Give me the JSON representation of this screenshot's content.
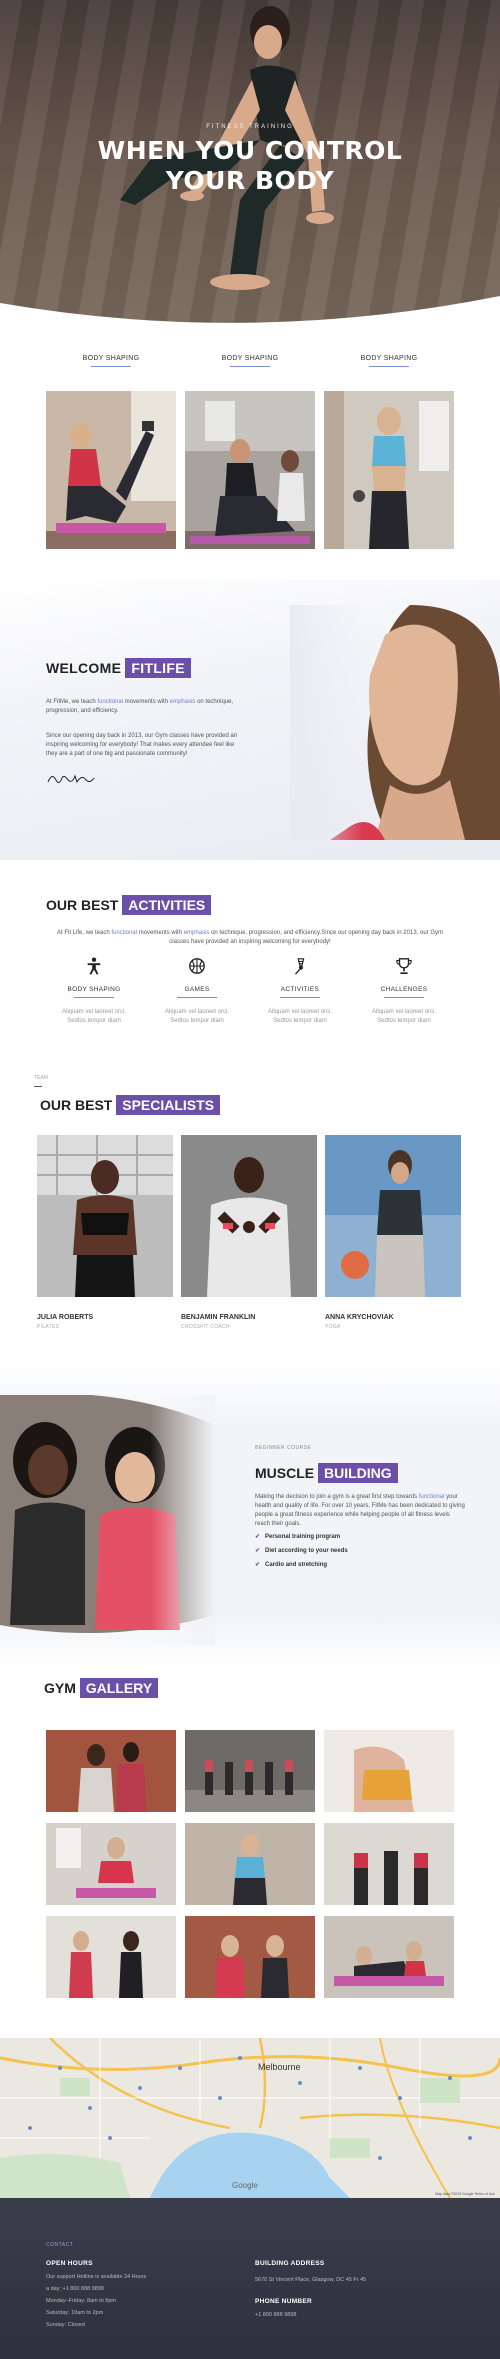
{
  "hero": {
    "tagline": "FITNESS TRAINING",
    "title_line1": "WHEN YOU CONTROL",
    "title_line2": "YOUR BODY"
  },
  "shaping": {
    "items": [
      {
        "label": "BODY SHAPING"
      },
      {
        "label": "BODY SHAPING"
      },
      {
        "label": "BODY SHAPING"
      }
    ]
  },
  "welcome": {
    "title_plain": "WELCOME",
    "title_accent": "FITLIFE",
    "p1_a": "At FitMe, we teach ",
    "p1_hl1": "functional",
    "p1_b": " movements with ",
    "p1_hl2": "emphasis",
    "p1_c": " on technique, progression, and efficiency.",
    "p2": "Since our opening day back in 2013, our Gym classes have provided an inspiring welcoming for everybody! That makes every attendee feel like they are a part of one big and passionate community!",
    "signature": "Dave Bm"
  },
  "activities": {
    "title_plain": "OUR BEST",
    "title_accent": "ACTIVITIES",
    "intro_a": "At Fit Life, we teach ",
    "intro_hl1": "functional",
    "intro_b": " movements with ",
    "intro_hl2": "emphasis",
    "intro_c": " on technique, progression, and efficiency.Since our opening day back in 2013, our Gym classes have provided an inspiring welcoming for everybody!",
    "items": [
      {
        "label": "BODY SHAPING",
        "desc": "Aliquam vel laoreet orci. Sedtos tempor diam",
        "icon": "fitness-person-icon"
      },
      {
        "label": "GAMES",
        "desc": "Aliquam vel laoreet orci. Sedtos tempor diam",
        "icon": "basketball-icon"
      },
      {
        "label": "ACTIVITIES",
        "desc": "Aliquam vel laoreet orci. Sedtos tempor diam",
        "icon": "badminton-icon"
      },
      {
        "label": "CHALLENGES",
        "desc": "Aliquam vel laoreet orci. Sedtos tempor diam",
        "icon": "trophy-icon"
      }
    ]
  },
  "specialists": {
    "small": "TEAM",
    "title_plain": "OUR BEST",
    "title_accent": "SPECIALISTS",
    "people": [
      {
        "name": "JULIA ROBERTS",
        "role": "PILATES"
      },
      {
        "name": "BENJAMIN FRANKLIN",
        "role": "CROSSFIT COACH"
      },
      {
        "name": "ANNA KRYCHOVIAK",
        "role": "YOGA"
      }
    ]
  },
  "muscle": {
    "small": "BEGINNER COURSE",
    "title_plain": "MUSCLE",
    "title_accent": "BUILDING",
    "p_a": "Making the decision to join a gym is a great first step towards ",
    "p_hl": "functional",
    "p_b": " your health and quality of life. For over 10 years, FitMe has been dedicated to giving people a great fitness experience while helping people of all fitness levels reach their goals.",
    "list": [
      "Personal training program",
      "Diet according to your needs",
      "Cardio and stretching"
    ]
  },
  "gallery": {
    "title_plain": "GYM",
    "title_accent": "GALLERY"
  },
  "map": {
    "city_label": "Melbourne",
    "google_label": "Google",
    "attribution": "Map data ©2019 Google   Terms of Use"
  },
  "footer": {
    "contact": "CONTACT",
    "hours_head": "OPEN HOURS",
    "hours_lines": [
      "Our support Hotline is available 24 Hours",
      "a day: +1 800 888 9898",
      "Monday–Friday: 8am to 8pm",
      "Saturday: 10am to 2pm",
      "Sunday: Closed"
    ],
    "address_head": "BUILDING ADDRESS",
    "address": "5670 St Vincent Place, Glasgow, DC 45 Fr 45",
    "phone_head": "PHONE NUMBER",
    "phone": "+1 800 888 9898"
  },
  "colors": {
    "accent": "#6b4fa8",
    "link": "#6b7fd0",
    "footer_bg": "#2e313d"
  }
}
